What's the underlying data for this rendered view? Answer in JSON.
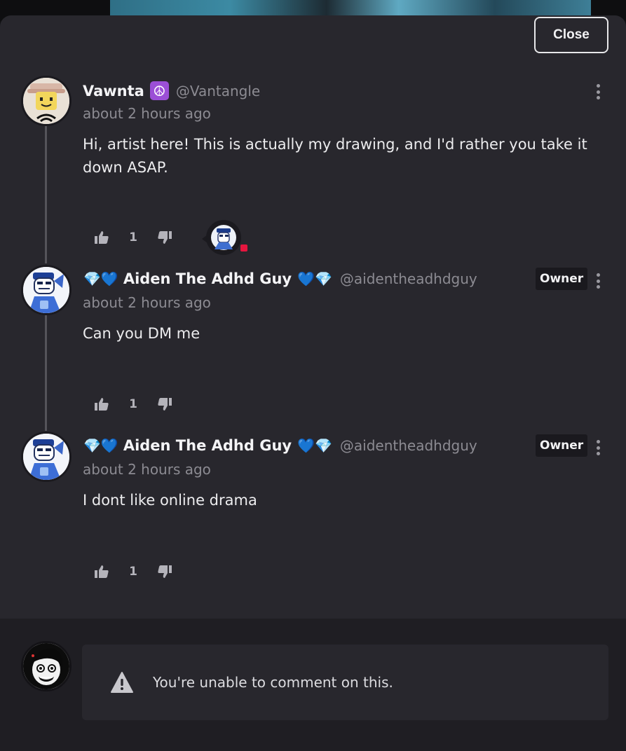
{
  "close_label": "Close",
  "comments": [
    {
      "name": "Vawnta",
      "badge": "☮",
      "handle": "@Vantangle",
      "time": "about 2 hours ago",
      "text": "Hi, artist here! This is actually my drawing, and I'd rather you take it down ASAP.",
      "likes": "1",
      "owner": ""
    },
    {
      "prefix": "💎💙",
      "name": "Aiden The Adhd Guy",
      "suffix": "💙💎",
      "handle": "@aidentheadhdguy",
      "time": "about 2 hours ago",
      "text": "Can you DM me",
      "likes": "1",
      "owner": "Owner"
    },
    {
      "prefix": "💎💙",
      "name": "Aiden The Adhd Guy",
      "suffix": "💙💎",
      "handle": "@aidentheadhdguy",
      "time": "about 2 hours ago",
      "text": "I dont like online drama",
      "likes": "1",
      "owner": "Owner"
    }
  ],
  "footer": {
    "notice": "You're unable to comment on this."
  },
  "colors": {
    "sheet_bg": "#28272d",
    "footer_bg": "#1f1e23",
    "muted_text": "#8c8b92",
    "badge_purple": "#9b4fd6",
    "notify_red": "#e6163f"
  },
  "icons": [
    "thumbs-up-icon",
    "thumbs-down-icon",
    "kebab-menu-icon",
    "warning-icon",
    "peace-icon"
  ]
}
